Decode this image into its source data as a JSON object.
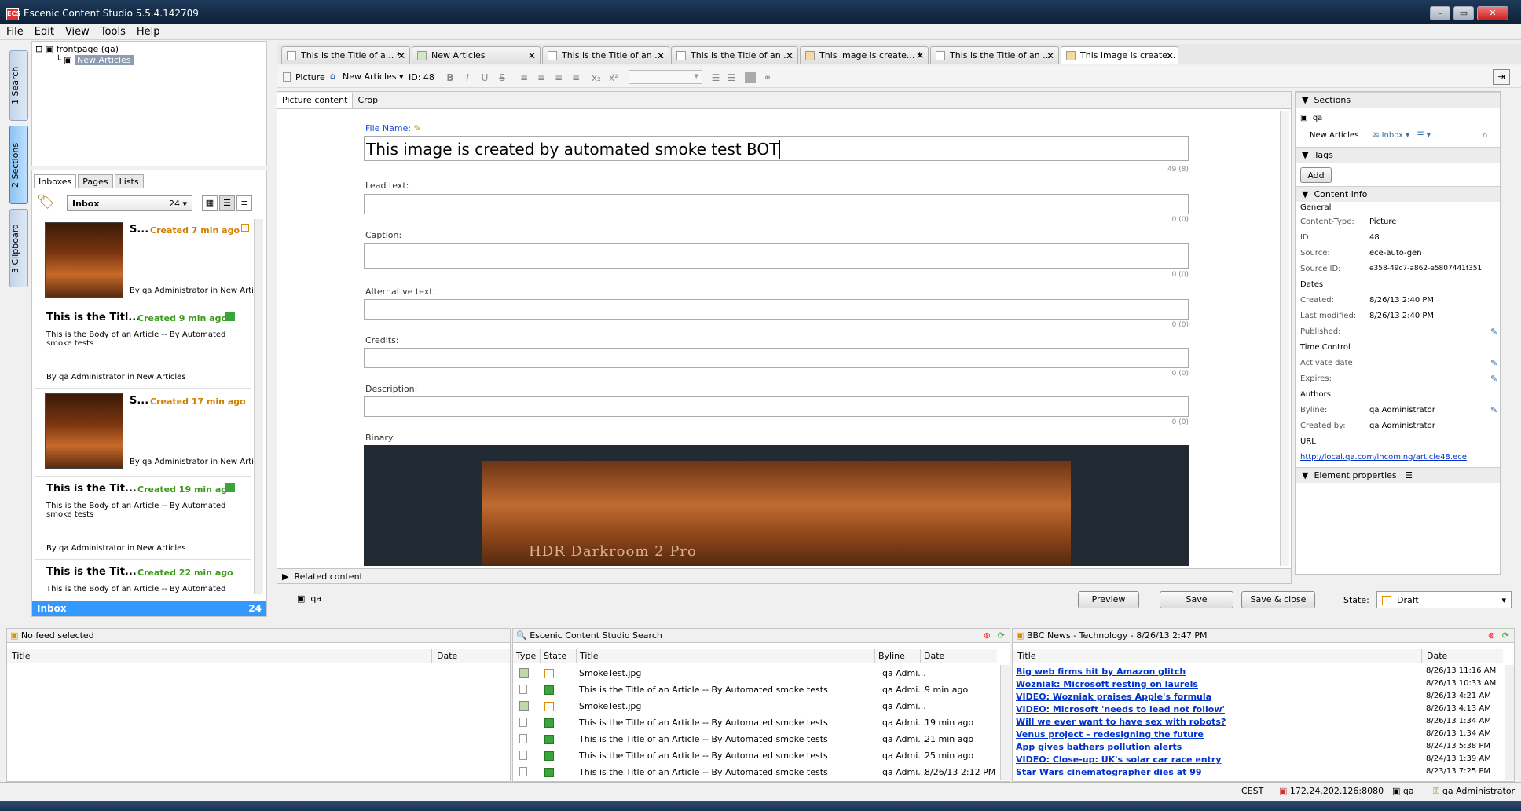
{
  "window": {
    "title": "Escenic Content Studio 5.5.4.142709",
    "logo": "ECS"
  },
  "menu": [
    "File",
    "Edit",
    "View",
    "Tools",
    "Help"
  ],
  "left_strip": {
    "tabs": [
      "1 Search",
      "2 Sections",
      "3 Clipboard"
    ]
  },
  "tree": {
    "root": "frontpage (qa)",
    "child": "New Articles"
  },
  "inbox": {
    "tabs": [
      "Inboxes",
      "Pages",
      "Lists"
    ],
    "selector": "Inbox",
    "count": "24",
    "items": [
      {
        "title": "S...",
        "created": "Created 7 min ago",
        "body": "",
        "byline": "By qa Administrator in New Artic",
        "kind": "image"
      },
      {
        "title": "This is the Titl...",
        "created": "Created 9 min ago",
        "body": "This is the Body of an Article -- By Automated smoke tests",
        "byline": "By qa Administrator in New Articles",
        "kind": "article"
      },
      {
        "title": "S...",
        "created": "Created 17 min ago",
        "body": "",
        "byline": "By qa Administrator in New Artic",
        "kind": "image"
      },
      {
        "title": "This is the Tit...",
        "created": "Created 19 min ago",
        "body": "This is the Body of an Article -- By Automated smoke tests",
        "byline": "By qa Administrator in New Articles",
        "kind": "article"
      },
      {
        "title": "This is the Tit...",
        "created": "Created 22 min ago",
        "body": "This is the Body of an Article -- By Automated",
        "byline": "",
        "kind": "article"
      }
    ],
    "footer_label": "Inbox",
    "footer_count": "24"
  },
  "doc_tabs": [
    {
      "label": "This is the Title of a... *"
    },
    {
      "label": "New Articles"
    },
    {
      "label": "This is the Title of an ..."
    },
    {
      "label": "This is the Title of an ..."
    },
    {
      "label": "This image is create... *"
    },
    {
      "label": "This is the Title of an ..."
    },
    {
      "label": "This image is create... *"
    }
  ],
  "toolbar": {
    "type": "Picture",
    "section": "New Articles",
    "id": "ID: 48",
    "sub": "x₂",
    "sup": "x²"
  },
  "editor": {
    "subtabs": [
      "Picture content",
      "Crop"
    ],
    "filename_label": "File Name:",
    "filename_value": "This image is created by automated smoke test BOT",
    "filename_counter": "49 (8)",
    "fields": [
      {
        "label": "Lead text:",
        "counter": "0 (0)"
      },
      {
        "label": "Caption:",
        "counter": "0 (0)"
      },
      {
        "label": "Alternative text:",
        "counter": "0 (0)"
      },
      {
        "label": "Credits:",
        "counter": "0 (0)"
      },
      {
        "label": "Description:",
        "counter": "0 (0)"
      }
    ],
    "binary_label": "Binary:",
    "binary_watermark": "HDR Darkroom 2 Pro"
  },
  "related": {
    "label": "Related content"
  },
  "bottom": {
    "section": "qa",
    "preview": "Preview",
    "save": "Save",
    "save_close": "Save & close",
    "state_label": "State:",
    "state_value": "Draft"
  },
  "right_panel": {
    "sections_head": "Sections",
    "section_name": "qa",
    "section_home": "New Articles",
    "inbox_label": "Inbox",
    "tags_head": "Tags",
    "add_button": "Add",
    "content_info_head": "Content info",
    "general": "General",
    "rows": [
      {
        "k": "Content-Type:",
        "v": "Picture"
      },
      {
        "k": "ID:",
        "v": "48"
      },
      {
        "k": "Source:",
        "v": "ece-auto-gen"
      },
      {
        "k": "Source ID:",
        "v": "e358-49c7-a862-e5807441f351"
      }
    ],
    "dates": "Dates",
    "created_k": "Created:",
    "created_v": "8/26/13 2:40 PM",
    "modified_k": "Last modified:",
    "modified_v": "8/26/13 2:40 PM",
    "published_k": "Published:",
    "time_control": "Time Control",
    "activate_k": "Activate date:",
    "expires_k": "Expires:",
    "authors": "Authors",
    "byline_k": "Byline:",
    "byline_v": "qa Administrator",
    "createdby_k": "Created by:",
    "createdby_v": "qa Administrator",
    "url_head": "URL",
    "url": "http://local.qa.com/incoming/article48.ece",
    "element_props": "Element properties"
  },
  "feed_left": {
    "title": "No feed selected",
    "col_title": "Title",
    "col_date": "Date"
  },
  "search": {
    "title": "Escenic Content Studio Search",
    "cols": [
      "Type",
      "State",
      "Title",
      "Byline",
      "Date"
    ],
    "rows": [
      {
        "type": "image",
        "state": "o",
        "title": "SmokeTest.jpg",
        "byline": "qa Admi...",
        "date": ""
      },
      {
        "type": "doc",
        "state": "g",
        "title": "This is the Title of an Article -- By Automated smoke tests",
        "byline": "qa Admi...",
        "date": "9 min ago"
      },
      {
        "type": "image",
        "state": "o",
        "title": "SmokeTest.jpg",
        "byline": "qa Admi...",
        "date": ""
      },
      {
        "type": "doc",
        "state": "g",
        "title": "This is the Title of an Article -- By Automated smoke tests",
        "byline": "qa Admi...",
        "date": "19 min ago"
      },
      {
        "type": "doc",
        "state": "g",
        "title": "This is the Title of an Article -- By Automated smoke tests",
        "byline": "qa Admi...",
        "date": "21 min ago"
      },
      {
        "type": "doc",
        "state": "g",
        "title": "This is the Title of an Article -- By Automated smoke tests",
        "byline": "qa Admi...",
        "date": "25 min ago"
      },
      {
        "type": "doc",
        "state": "g",
        "title": "This is the Title of an Article -- By Automated smoke tests",
        "byline": "qa Admi...",
        "date": "8/26/13 2:12 PM"
      }
    ]
  },
  "bbc": {
    "title": "BBC News - Technology - 8/26/13 2:47 PM",
    "col_title": "Title",
    "col_date": "Date",
    "rows": [
      {
        "title": "Big web firms hit by Amazon glitch",
        "date": "8/26/13 11:16 AM"
      },
      {
        "title": "Wozniak: Microsoft resting on laurels",
        "date": "8/26/13 10:33 AM"
      },
      {
        "title": "VIDEO: Wozniak praises Apple's formula",
        "date": "8/26/13 4:21 AM"
      },
      {
        "title": "VIDEO: Microsoft 'needs to lead not follow'",
        "date": "8/26/13 4:13 AM"
      },
      {
        "title": "Will we ever want to have sex with robots?",
        "date": "8/26/13 1:34 AM"
      },
      {
        "title": "Venus project – redesigning the future",
        "date": "8/26/13 1:34 AM"
      },
      {
        "title": "App gives bathers pollution alerts",
        "date": "8/24/13 5:38 PM"
      },
      {
        "title": "VIDEO: Close-up: UK's solar car race entry",
        "date": "8/24/13 1:39 AM"
      },
      {
        "title": "Star Wars cinematographer dies at 99",
        "date": "8/23/13 7:25 PM"
      }
    ]
  },
  "status": {
    "tz": "CEST",
    "server": "172.24.202.126:8080",
    "pub": "qa",
    "user": "qa Administrator"
  }
}
